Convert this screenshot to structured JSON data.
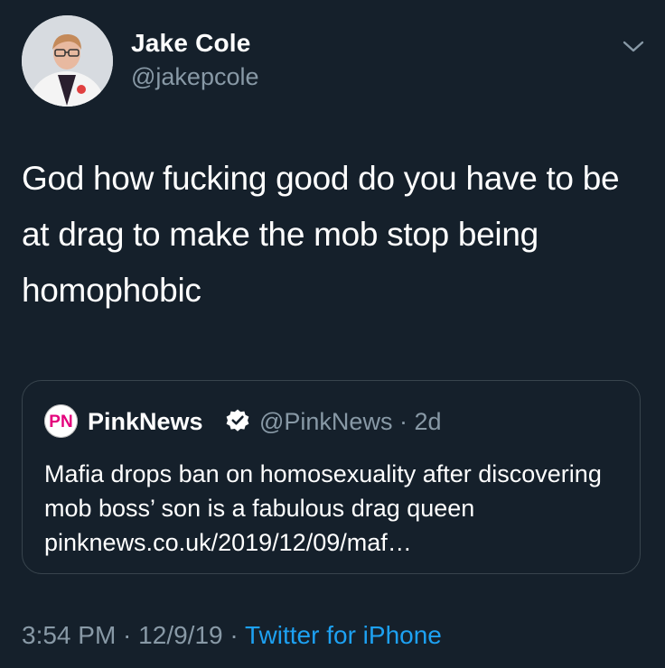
{
  "tweet": {
    "author_name": "Jake Cole",
    "author_handle": "@jakepcole",
    "text": "God how fucking good do you have to be at drag to make the mob stop being homophobic",
    "time": "3:54 PM",
    "date": "12/9/19",
    "source": "Twitter for iPhone",
    "separator": " · "
  },
  "quoted": {
    "logo_text": "PN",
    "author_name": "PinkNews",
    "author_handle": "@PinkNews",
    "age": "2d",
    "separator": " · ",
    "text": "Mafia drops ban on homosexuality after discovering mob boss’ son is a fabulous drag queen pinknews.co.uk/2019/12/09/maf…"
  },
  "icons": {
    "menu": "chevron-down-icon",
    "verified": "verified-badge-icon"
  },
  "colors": {
    "background": "#15202b",
    "secondary_text": "#8899a6",
    "link": "#1da1f2",
    "border": "#38444d",
    "brand_pink": "#e4007c"
  }
}
